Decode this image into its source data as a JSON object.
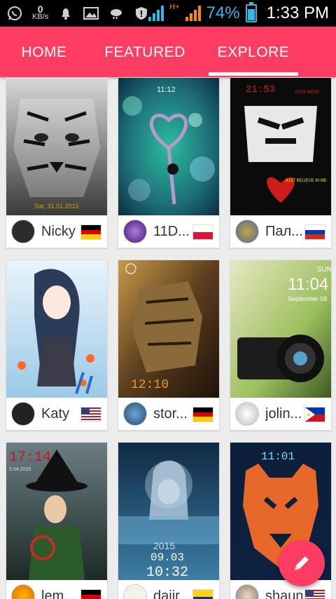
{
  "statusbar": {
    "netspeed_value": "0",
    "netspeed_unit": "KB/s",
    "network_label": "H+",
    "battery_percent": "74%",
    "time": "1:33 PM"
  },
  "tabs": {
    "home": "HOME",
    "featured": "FEATURED",
    "explore": "EXPLORE",
    "active": "EXPLORE"
  },
  "cards": [
    {
      "user": "Nicky",
      "flag": "germany"
    },
    {
      "user": "11D...",
      "flag": "poland"
    },
    {
      "user": "Пал...",
      "flag": "russia"
    },
    {
      "user": "Katy",
      "flag": "usa"
    },
    {
      "user": "stor...",
      "flag": "germany"
    },
    {
      "user": "jolin...",
      "flag": "philippines"
    },
    {
      "user": "lem...",
      "flag": "germany"
    },
    {
      "user": "daiir...",
      "flag": "colombia"
    },
    {
      "user": "shaun...",
      "flag": "usa"
    }
  ],
  "thumb_texts": {
    "c1_date": "Sat, 31.01.2015",
    "c2_time": "11:12",
    "c3_time": "21:53",
    "c3_date": "2015 08/26",
    "c3_caption": "JUST BELIEVE IN ME",
    "c5_time": "12:10",
    "c6_day": "SUN",
    "c6_time": "11:04",
    "c6_date": "September 06",
    "c7_time": "17:14",
    "c7_date": "5.04.2015",
    "c8_year": "2015",
    "c8_date": "09.03",
    "c8_time": "10:32",
    "c9_time": "11:01"
  },
  "colors": {
    "accent": "#ff3d63",
    "status_blue": "#33b5e5",
    "background": "#ececec"
  },
  "fab": {
    "icon": "pencil-icon"
  }
}
